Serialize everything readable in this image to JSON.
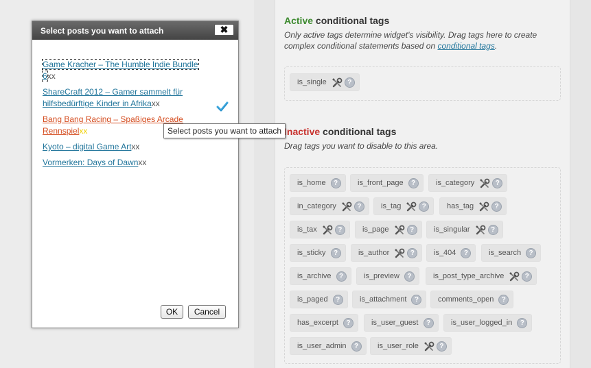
{
  "panel": {
    "active": {
      "title_accent": "Active",
      "title_rest": " conditional tags",
      "desc_before": "Only active tags determine widget's visibility. Drag tags here to create complex conditional statements based on ",
      "desc_link": "conditional tags",
      "desc_after": ".",
      "tags": [
        {
          "label": "is_single",
          "tools": true
        }
      ]
    },
    "inactive": {
      "title_accent": "Inactive",
      "title_rest": " conditional tags",
      "desc": "Drag tags you want to disable to this area.",
      "tags": [
        {
          "label": "is_home",
          "tools": false
        },
        {
          "label": "is_front_page",
          "tools": false
        },
        {
          "label": "is_category",
          "tools": true
        },
        {
          "label": "in_category",
          "tools": true
        },
        {
          "label": "is_tag",
          "tools": true
        },
        {
          "label": "has_tag",
          "tools": true
        },
        {
          "label": "is_tax",
          "tools": true
        },
        {
          "label": "is_page",
          "tools": true
        },
        {
          "label": "is_singular",
          "tools": true
        },
        {
          "label": "is_sticky",
          "tools": false
        },
        {
          "label": "is_author",
          "tools": true
        },
        {
          "label": "is_404",
          "tools": false
        },
        {
          "label": "is_search",
          "tools": false
        },
        {
          "label": "is_archive",
          "tools": false
        },
        {
          "label": "is_preview",
          "tools": false
        },
        {
          "label": "is_post_type_archive",
          "tools": true
        },
        {
          "label": "is_paged",
          "tools": false
        },
        {
          "label": "is_attachment",
          "tools": false
        },
        {
          "label": "comments_open",
          "tools": false
        },
        {
          "label": "has_excerpt",
          "tools": false
        },
        {
          "label": "is_user_guest",
          "tools": false
        },
        {
          "label": "is_user_logged_in",
          "tools": false
        },
        {
          "label": "is_user_admin",
          "tools": false
        },
        {
          "label": "is_user_role",
          "tools": true
        }
      ]
    }
  },
  "modal": {
    "title": "Select posts you want to attach",
    "close_label": "✖",
    "posts": [
      {
        "title": "Game Kracher – The Humble Indie Bundle 6",
        "suffix": "xx",
        "selected": false,
        "focused": true
      },
      {
        "title": "ShareCraft 2012 – Gamer sammelt für hilfsbedürftige Kinder in Afrika",
        "suffix": "xx",
        "selected": false,
        "focused": false
      },
      {
        "title": "Bang Bang Racing – Spaßiges Arcade Rennspiel",
        "suffix": "xx",
        "selected": true,
        "focused": false
      },
      {
        "title": "Kyoto – digital Game Art",
        "suffix": "xx",
        "selected": false,
        "focused": false
      },
      {
        "title": "Vormerken: Days of Dawn",
        "suffix": "xx",
        "selected": false,
        "focused": false
      }
    ],
    "ok_label": "OK",
    "cancel_label": "Cancel"
  },
  "tooltip": "Select posts you want to attach",
  "colors": {
    "link": "#21759b",
    "selected_link": "#d54e21",
    "active_accent": "#3d8a2f",
    "inactive_accent": "#c8322e",
    "check": "#3fa9e0"
  }
}
